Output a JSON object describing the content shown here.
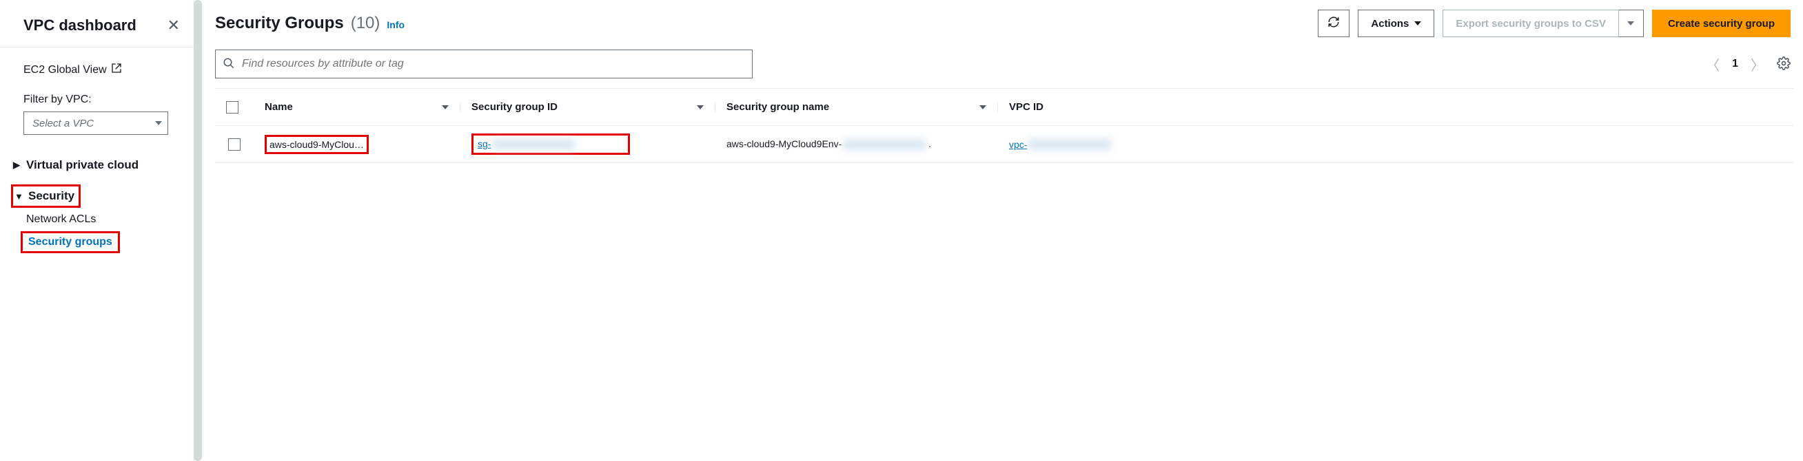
{
  "sidebar": {
    "title": "VPC dashboard",
    "ec2_global": "EC2 Global View",
    "filter_label": "Filter by VPC:",
    "vpc_placeholder": "Select a VPC",
    "groups": {
      "vpc": {
        "label": "Virtual private cloud",
        "expanded": false
      },
      "security": {
        "label": "Security",
        "expanded": true,
        "items": [
          {
            "label": "Network ACLs",
            "active": false
          },
          {
            "label": "Security groups",
            "active": true
          }
        ]
      }
    }
  },
  "header": {
    "title": "Security Groups",
    "count": "(10)",
    "info": "Info",
    "actions_label": "Actions",
    "export_label": "Export security groups to CSV",
    "create_label": "Create security group"
  },
  "search": {
    "placeholder": "Find resources by attribute or tag"
  },
  "pagination": {
    "page": "1"
  },
  "table": {
    "columns": {
      "name": "Name",
      "sg_id": "Security group ID",
      "sg_name": "Security group name",
      "vpc_id": "VPC ID"
    },
    "rows": [
      {
        "name": "aws-cloud9-MyClou…",
        "sg_id": "sg-",
        "sg_name_prefix": "aws-cloud9-MyCloud9Env-",
        "sg_name_suffix": ".",
        "vpc_id": "vpc-"
      }
    ]
  }
}
